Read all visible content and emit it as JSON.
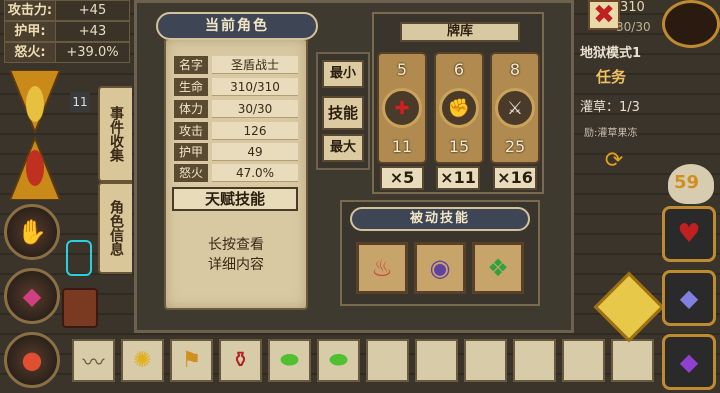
{
  "stats": [
    {
      "label": "攻击力:",
      "value": "+45"
    },
    {
      "label": "护甲:",
      "value": "+43"
    },
    {
      "label": "怒火:",
      "value": "+39.0%"
    }
  ],
  "side_badge": "11",
  "tabs": {
    "event": "事件收集",
    "role": "角色信息"
  },
  "card": {
    "title": "当前角色",
    "rows": [
      {
        "k": "名字",
        "v": "圣盾战士"
      },
      {
        "k": "生命",
        "v": "310/310"
      },
      {
        "k": "体力",
        "v": "30/30"
      },
      {
        "k": "攻击",
        "v": "126"
      },
      {
        "k": "护甲",
        "v": "49"
      },
      {
        "k": "怒火",
        "v": "47.0%"
      }
    ],
    "talent_button": "天赋技能",
    "hint_line1": "长按查看",
    "hint_line2": "详细内容"
  },
  "sort": {
    "min": "最小",
    "skill": "技能",
    "max": "最大"
  },
  "deck": {
    "title": "牌库",
    "cards": [
      {
        "top": "5",
        "bottom": "11",
        "icon": "red-cross-icon",
        "count": "×5"
      },
      {
        "top": "6",
        "bottom": "15",
        "icon": "fist-icon",
        "count": "×11"
      },
      {
        "top": "8",
        "bottom": "25",
        "icon": "sword-icon",
        "count": "×16"
      }
    ]
  },
  "passive": {
    "title": "被动技能",
    "slots": [
      "fire-spirit-icon",
      "dark-orb-icon",
      "green-turtle-icon"
    ]
  },
  "right": {
    "hp_partial": "310",
    "hp_partial2": "30/30",
    "mode": "地狱模式1",
    "quest": "任务",
    "quest_item": "灌草：1/3",
    "reward": "励:灌草果冻",
    "gold": "59"
  },
  "inventory": [
    "scroll-icon",
    "sun-icon",
    "flag-icon",
    "potion-icon",
    "green-slime-icon",
    "green-slime-icon",
    "",
    "",
    "",
    "",
    "",
    ""
  ]
}
